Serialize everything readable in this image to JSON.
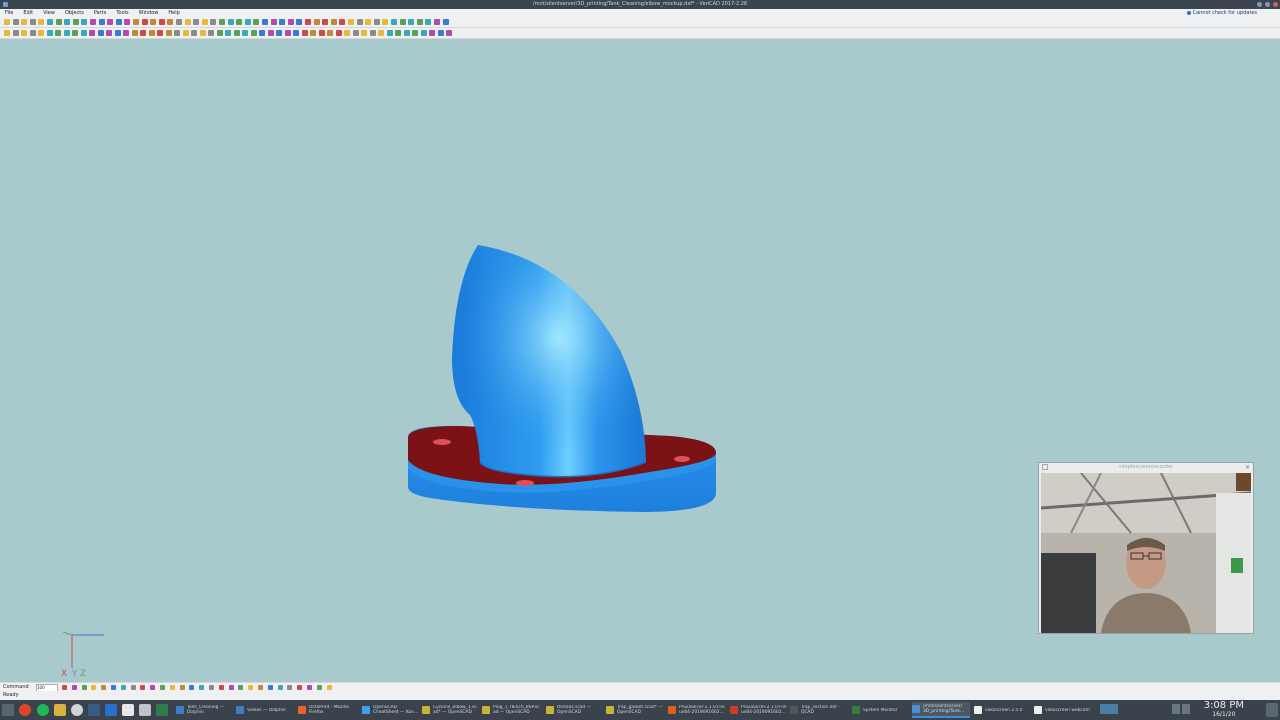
{
  "window": {
    "title": "/mnt/silentserver/3D_printing/Tank_Cleaning/elbow_mockup.dxf* - VeriCAD 2017-2.28",
    "update_notice": "Cannot check for updates"
  },
  "menu": [
    "File",
    "Edit",
    "View",
    "Objects",
    "Parts",
    "Tools",
    "Window",
    "Help"
  ],
  "command_bar": {
    "label": "Command",
    "value": "100"
  },
  "status": {
    "text": "Ready"
  },
  "axis": {
    "x": "X",
    "y": "Y",
    "z": "Z"
  },
  "webcam": {
    "title": "simplescreenrecorder"
  },
  "taskbar": {
    "tasks": [
      {
        "label": "Tank_Cleaning —\nDolphin",
        "icon_color": "#3d7fc4"
      },
      {
        "label": "Videos — Dolphin",
        "icon_color": "#3d7fc4"
      },
      {
        "label": "OctoPrint - Mozilla\nFirefox",
        "icon_color": "#e8632b"
      },
      {
        "label": "OpenSCAD\nCheatSheet — Kon...",
        "icon_color": "#3ea0e8"
      },
      {
        "label": "Cyclone_elbow_1.sc\nad* — OpenSCAD",
        "icon_color": "#c7b23a"
      },
      {
        "label": "Plug_1.78inch_BSP.sc\nad — OpenSCAD",
        "icon_color": "#c7b23a"
      },
      {
        "label": "threads.scad —\nOpenSCAD",
        "icon_color": "#c7b23a"
      },
      {
        "label": "Trap_gasket.scad* —\nOpenSCAD",
        "icon_color": "#c7b23a"
      },
      {
        "label": "PrusaSlicer-2.1.0+lin\nux64-2019091602...",
        "icon_color": "#e85a1a"
      },
      {
        "label": "PrusaSlicer-2.1.0+lin\nux64-2019091602...",
        "icon_color": "#d03a2a"
      },
      {
        "label": "Trap_section.dxf -\nQCAD",
        "icon_color": "#555555"
      },
      {
        "label": "System Monitor",
        "icon_color": "#3a7a3a"
      },
      {
        "label": "/mnt/silentserver/\n3D_printing/Tank...",
        "icon_color": "#4a90d9",
        "active": true
      },
      {
        "label": "vokoscreen 2.5.0",
        "icon_color": "#eeeeee"
      },
      {
        "label": "vokoscreen webcam",
        "icon_color": "#eeeeee"
      }
    ],
    "clock": {
      "time": "3:08 PM",
      "date": "16/1/20"
    }
  }
}
